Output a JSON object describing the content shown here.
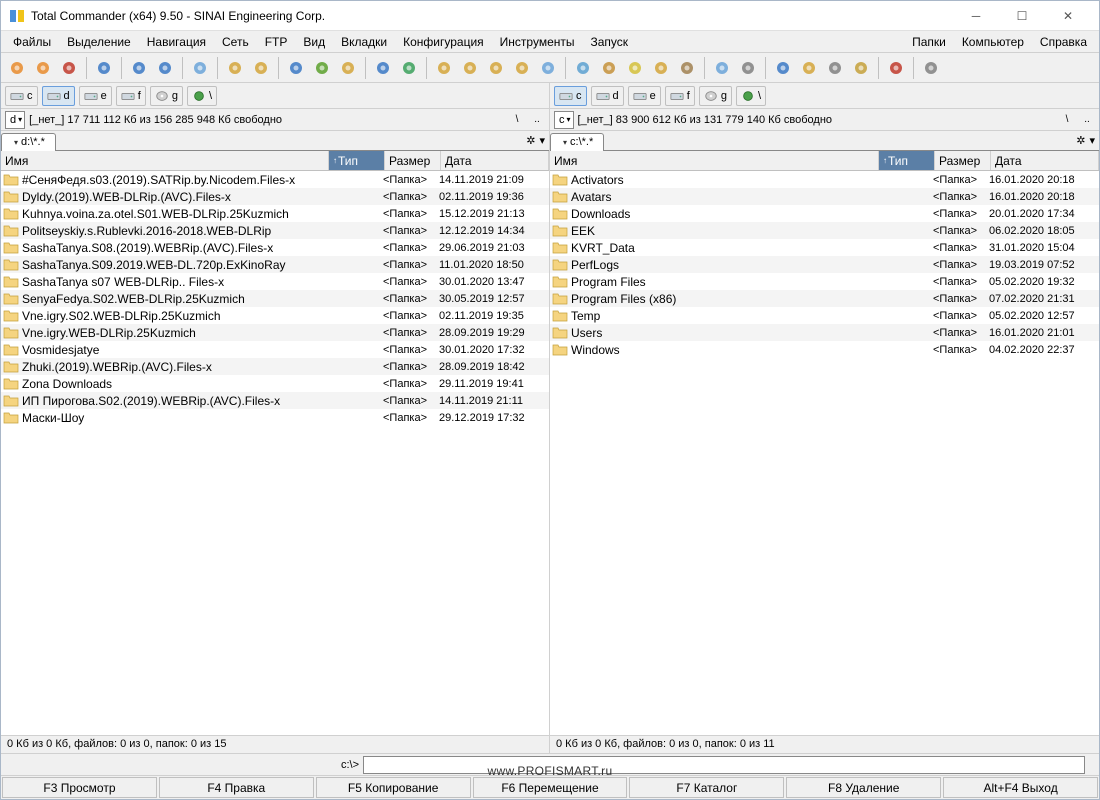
{
  "title": "Total Commander (x64) 9.50 - SINAI Engineering Corp.",
  "menu": {
    "items": [
      "Файлы",
      "Выделение",
      "Навигация",
      "Сеть",
      "FTP",
      "Вид",
      "Вкладки",
      "Конфигурация",
      "Инструменты",
      "Запуск"
    ],
    "right": [
      "Папки",
      "Компьютер",
      "Справка"
    ]
  },
  "toolbar_icons": [
    "gear-orange",
    "gear-orange-2",
    "gear-red",
    "sep",
    "refresh",
    "sep",
    "arrow-left",
    "arrow-right",
    "sep",
    "zoom",
    "sep",
    "grid-1",
    "grid-2",
    "sep",
    "star-blue",
    "sort",
    "clipboard",
    "sep",
    "ie",
    "globe",
    "sep",
    "doc-1",
    "doc-2",
    "doc-3",
    "doc-4",
    "tiles",
    "sep",
    "calc",
    "hammer",
    "table",
    "folder-y",
    "notebook",
    "sep",
    "tool-1",
    "disk",
    "sep",
    "shield",
    "people",
    "disk-g",
    "cd",
    "sep",
    "ball",
    "sep",
    "wand"
  ],
  "left": {
    "drives": [
      {
        "letter": "c",
        "icon": "hdd",
        "active": false
      },
      {
        "letter": "d",
        "icon": "hdd",
        "active": true
      },
      {
        "letter": "e",
        "icon": "hdd",
        "active": false
      },
      {
        "letter": "f",
        "icon": "hdd",
        "active": false
      },
      {
        "letter": "g",
        "icon": "cd",
        "active": false
      },
      {
        "letter": "\\",
        "icon": "net",
        "active": false
      }
    ],
    "combo": "d",
    "info": "[_нет_]  17 711 112 Кб из 156 285 948 Кб свободно",
    "tab": "d:\\*.*",
    "cols": {
      "name": "Имя",
      "ext": "Тип",
      "size": "Размер",
      "date": "Дата",
      "sort": "↑"
    },
    "files": [
      {
        "name": "#СеняФедя.s03.(2019).SATRip.by.Nicodem.Files-x",
        "size": "<Папка>",
        "date": "14.11.2019 21:09"
      },
      {
        "name": "Dyldy.(2019).WEB-DLRip.(AVC).Files-x",
        "size": "<Папка>",
        "date": "02.11.2019 19:36"
      },
      {
        "name": "Kuhnya.voina.za.otel.S01.WEB-DLRip.25Kuzmich",
        "size": "<Папка>",
        "date": "15.12.2019 21:13"
      },
      {
        "name": "Politseyskiy.s.Rublevki.2016-2018.WEB-DLRip",
        "size": "<Папка>",
        "date": "12.12.2019 14:34"
      },
      {
        "name": "SashaTanya.S08.(2019).WEBRip.(AVC).Files-x",
        "size": "<Папка>",
        "date": "29.06.2019 21:03"
      },
      {
        "name": "SashaTanya.S09.2019.WEB-DL.720p.ExKinoRay",
        "size": "<Папка>",
        "date": "11.01.2020 18:50"
      },
      {
        "name": "SashaTanya  s07   WEB-DLRip.. Files-x",
        "size": "<Папка>",
        "date": "30.01.2020 13:47"
      },
      {
        "name": "SenyaFedya.S02.WEB-DLRip.25Kuzmich",
        "size": "<Папка>",
        "date": "30.05.2019 12:57"
      },
      {
        "name": "Vne.igry.S02.WEB-DLRip.25Kuzmich",
        "size": "<Папка>",
        "date": "02.11.2019 19:35"
      },
      {
        "name": "Vne.igry.WEB-DLRip.25Kuzmich",
        "size": "<Папка>",
        "date": "28.09.2019 19:29"
      },
      {
        "name": "Vosmidesjatye",
        "size": "<Папка>",
        "date": "30.01.2020 17:32"
      },
      {
        "name": "Zhuki.(2019).WEBRip.(AVC).Files-x",
        "size": "<Папка>",
        "date": "28.09.2019 18:42"
      },
      {
        "name": "Zona Downloads",
        "size": "<Папка>",
        "date": "29.11.2019 19:41"
      },
      {
        "name": "ИП Пирогова.S02.(2019).WEBRip.(AVC).Files-x",
        "size": "<Папка>",
        "date": "14.11.2019 21:11"
      },
      {
        "name": "Маски-Шоу",
        "size": "<Папка>",
        "date": "29.12.2019 17:32"
      }
    ],
    "status": "0 Кб из 0 Кб, файлов: 0 из 0, папок: 0 из 15"
  },
  "right": {
    "drives": [
      {
        "letter": "c",
        "icon": "hdd",
        "active": true
      },
      {
        "letter": "d",
        "icon": "hdd",
        "active": false
      },
      {
        "letter": "e",
        "icon": "hdd",
        "active": false
      },
      {
        "letter": "f",
        "icon": "hdd",
        "active": false
      },
      {
        "letter": "g",
        "icon": "cd",
        "active": false
      },
      {
        "letter": "\\",
        "icon": "net",
        "active": false
      }
    ],
    "combo": "c",
    "info": "[_нет_]  83 900 612 Кб из 131 779 140 Кб свободно",
    "tab": "c:\\*.*",
    "cols": {
      "name": "Имя",
      "ext": "Тип",
      "size": "Размер",
      "date": "Дата",
      "sort": "↑"
    },
    "files": [
      {
        "name": "Activators",
        "size": "<Папка>",
        "date": "16.01.2020 20:18"
      },
      {
        "name": "Avatars",
        "size": "<Папка>",
        "date": "16.01.2020 20:18"
      },
      {
        "name": "Downloads",
        "size": "<Папка>",
        "date": "20.01.2020 17:34"
      },
      {
        "name": "EEK",
        "size": "<Папка>",
        "date": "06.02.2020 18:05"
      },
      {
        "name": "KVRT_Data",
        "size": "<Папка>",
        "date": "31.01.2020 15:04"
      },
      {
        "name": "PerfLogs",
        "size": "<Папка>",
        "date": "19.03.2019 07:52"
      },
      {
        "name": "Program Files",
        "size": "<Папка>",
        "date": "05.02.2020 19:32"
      },
      {
        "name": "Program Files (x86)",
        "size": "<Папка>",
        "date": "07.02.2020 21:31"
      },
      {
        "name": "Temp",
        "size": "<Папка>",
        "date": "05.02.2020 12:57"
      },
      {
        "name": "Users",
        "size": "<Папка>",
        "date": "16.01.2020 21:01"
      },
      {
        "name": "Windows",
        "size": "<Папка>",
        "date": "04.02.2020 22:37"
      }
    ],
    "status": "0 Кб из 0 Кб, файлов: 0 из 0, папок: 0 из 11"
  },
  "cmdline": {
    "label": "c:\\>",
    "value": ""
  },
  "fnkeys": [
    "F3 Просмотр",
    "F4 Правка",
    "F5 Копирование",
    "F6 Перемещение",
    "F7 Каталог",
    "F8 Удаление",
    "Alt+F4 Выход"
  ],
  "watermark": "www.PROFISMART.ru"
}
